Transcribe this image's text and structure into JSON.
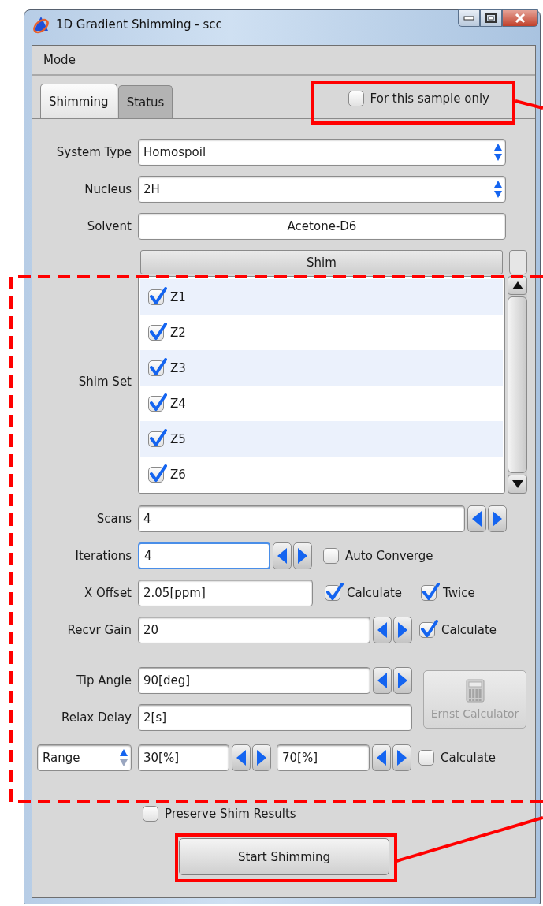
{
  "window": {
    "title": "1D Gradient Shimming - scc"
  },
  "menu": [
    "Mode"
  ],
  "tabs": [
    {
      "label": "Shimming",
      "selected": true
    },
    {
      "label": "Status",
      "selected": false
    }
  ],
  "sample_only": {
    "label": "For this sample only",
    "checked": false
  },
  "system_type": {
    "label": "System Type",
    "value": "Homospoil"
  },
  "nucleus": {
    "label": "Nucleus",
    "value": "2H"
  },
  "solvent": {
    "label": "Solvent",
    "value": "Acetone-D6"
  },
  "shim_set": {
    "label": "Shim Set",
    "column": "Shim",
    "items": [
      {
        "label": "Z1",
        "checked": true
      },
      {
        "label": "Z2",
        "checked": true
      },
      {
        "label": "Z3",
        "checked": true
      },
      {
        "label": "Z4",
        "checked": true
      },
      {
        "label": "Z5",
        "checked": true
      },
      {
        "label": "Z6",
        "checked": true
      }
    ]
  },
  "scans": {
    "label": "Scans",
    "value": "4"
  },
  "iterations": {
    "label": "Iterations",
    "value": "4",
    "focused": true
  },
  "auto_converge": {
    "label": "Auto Converge",
    "checked": false
  },
  "x_offset": {
    "label": "X Offset",
    "value": "2.05[ppm]"
  },
  "x_offset_calculate": {
    "label": "Calculate",
    "checked": true
  },
  "x_offset_twice": {
    "label": "Twice",
    "checked": true
  },
  "recvr_gain": {
    "label": "Recvr Gain",
    "value": "20"
  },
  "recvr_gain_calculate": {
    "label": "Calculate",
    "checked": true
  },
  "tip_angle": {
    "label": "Tip Angle",
    "value": "90[deg]"
  },
  "relax_delay": {
    "label": "Relax Delay",
    "value": "2[s]"
  },
  "ernst_calculator": {
    "label": "Ernst Calculator",
    "disabled": true
  },
  "range": {
    "mode": "Range",
    "low": "30[%]",
    "high": "70[%]"
  },
  "range_calculate": {
    "label": "Calculate",
    "checked": false
  },
  "preserve": {
    "label": "Preserve Shim Results",
    "checked": false
  },
  "start_button": {
    "label": "Start Shimming"
  }
}
